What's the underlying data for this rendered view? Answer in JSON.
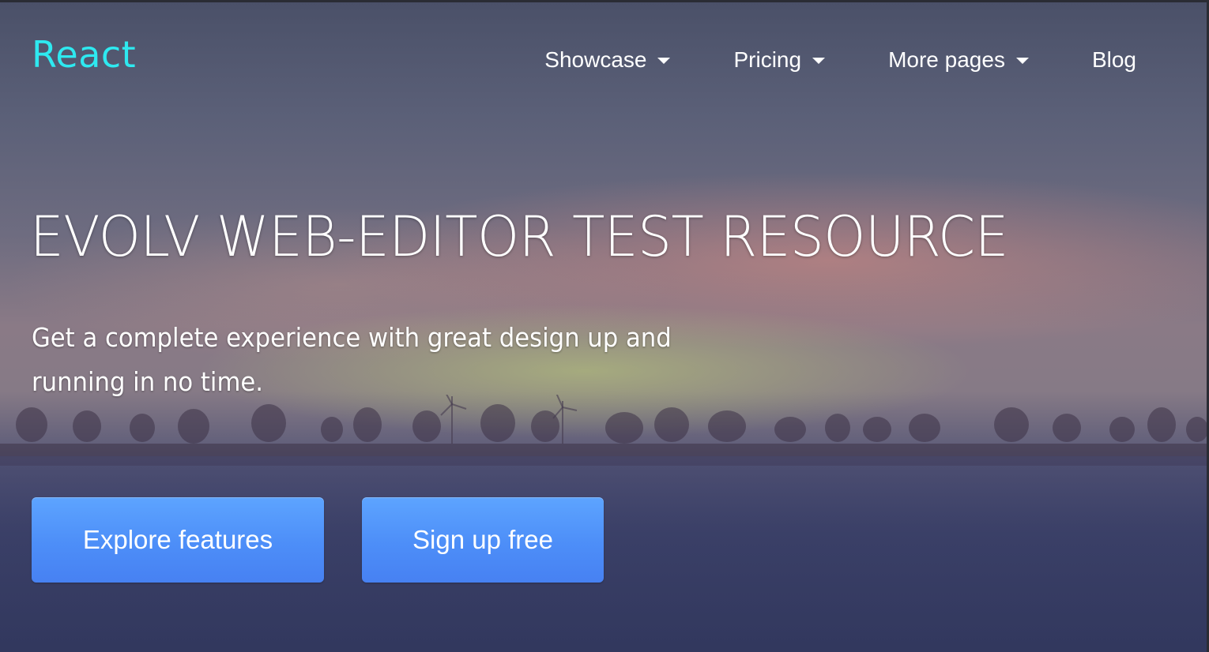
{
  "brand": {
    "label": "React",
    "color": "#2ee9f0"
  },
  "nav": {
    "items": [
      {
        "label": "Showcase",
        "has_dropdown": true,
        "icon": "caret-down-icon"
      },
      {
        "label": "Pricing",
        "has_dropdown": true,
        "icon": "caret-down-icon"
      },
      {
        "label": "More pages",
        "has_dropdown": true,
        "icon": "caret-down-icon"
      },
      {
        "label": "Blog",
        "has_dropdown": false
      }
    ]
  },
  "hero": {
    "headline": "EVOLV WEB-EDITOR TEST RESOURCE",
    "subtitle": "Get a complete experience with great design up and running in no time.",
    "background": "sunset-landscape-with-trees-and-wind-turbines"
  },
  "actions": {
    "explore_label": "Explore features",
    "signup_label": "Sign up free",
    "button_color": "#4d8ef8"
  }
}
